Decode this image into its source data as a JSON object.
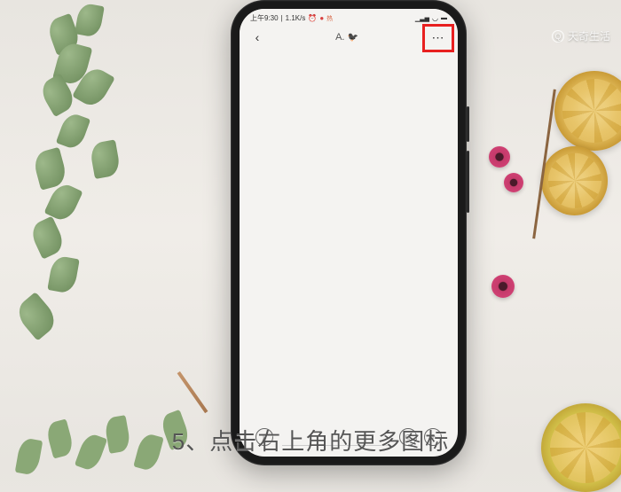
{
  "status_bar": {
    "time": "上午9:30",
    "speed": "1.1K/s",
    "alarm_icon": "⏰",
    "record_icon": "●",
    "hot_label": "热"
  },
  "app_header": {
    "back_icon": "‹",
    "title_prefix": "A.",
    "title_emoji": "🐦‍⬛",
    "more_icon": "⋯"
  },
  "input_bar": {
    "voice_icon": "🔊",
    "emoji_icon": "☺",
    "plus_icon": "+"
  },
  "watermark": {
    "icon": "Q",
    "text": "天奇生活"
  },
  "caption": "5、点击右上角的更多图标"
}
